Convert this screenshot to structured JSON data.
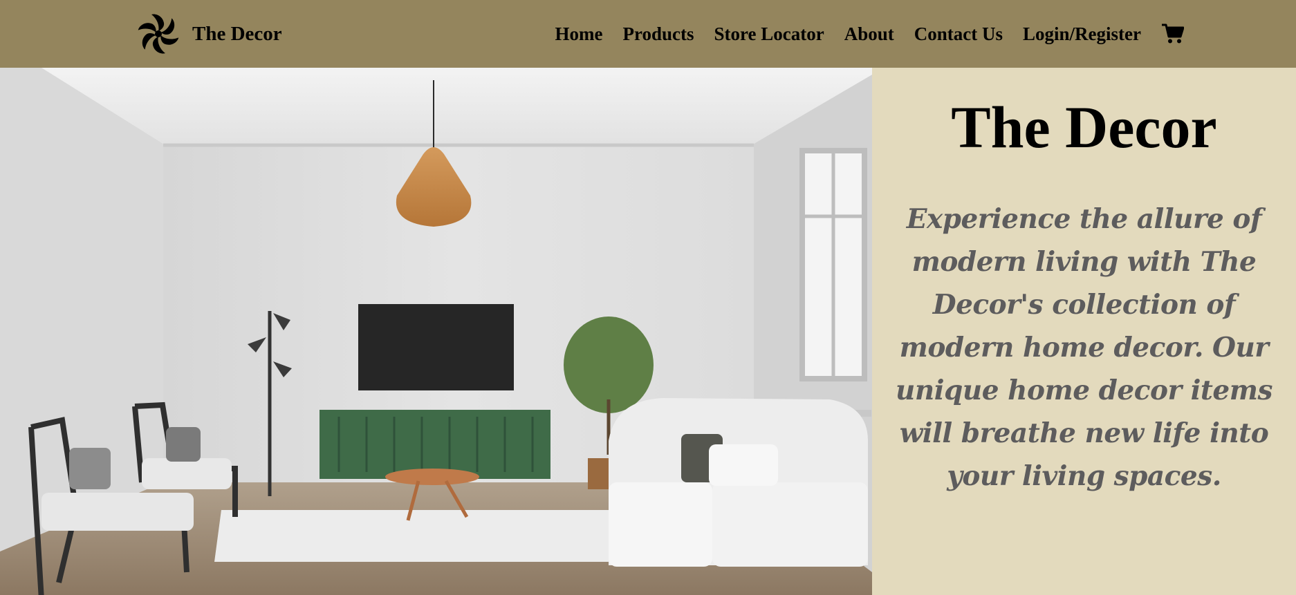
{
  "brand": {
    "name": "The Decor",
    "logo_icon": "pinwheel-logo-icon"
  },
  "nav": {
    "links": [
      "Home",
      "Products",
      "Store Locator",
      "About",
      "Contact Us",
      "Login/Register"
    ],
    "cart_icon": "shopping-cart-icon"
  },
  "hero": {
    "title": "The Decor",
    "tagline": "Experience the allure of modern living with The Decor's collection of modern home decor. Our unique home decor items will breathe new life into your living spaces."
  },
  "colors": {
    "navbar_bg": "#94855d",
    "panel_bg": "#e3dabd",
    "tagline_text": "#5d5c5d",
    "title_text": "#000000"
  }
}
